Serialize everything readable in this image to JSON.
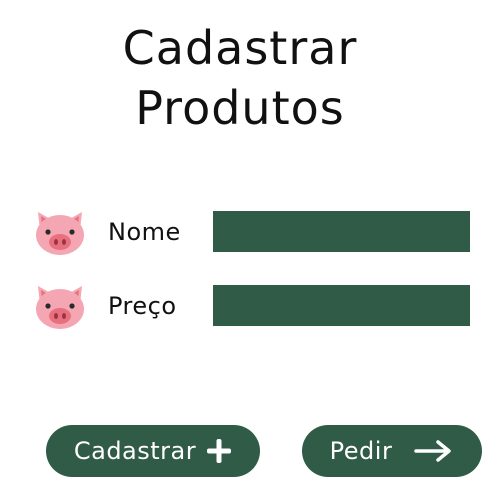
{
  "header": {
    "title_line1": "Cadastrar",
    "title_line2": "Produtos"
  },
  "form": {
    "name_label": "Nome",
    "name_value": "",
    "price_label": "Preço",
    "price_value": "",
    "field_color": "#2f5b47"
  },
  "actions": {
    "register_label": "Cadastrar",
    "order_label": "Pedir"
  },
  "icons": {
    "field_icon": "pig-face-icon",
    "register_icon": "plus-icon",
    "order_icon": "arrow-right-icon"
  },
  "colors": {
    "primary": "#2f5b47",
    "pig_pink": "#f4a7b3",
    "pig_snout": "#e8707e"
  }
}
